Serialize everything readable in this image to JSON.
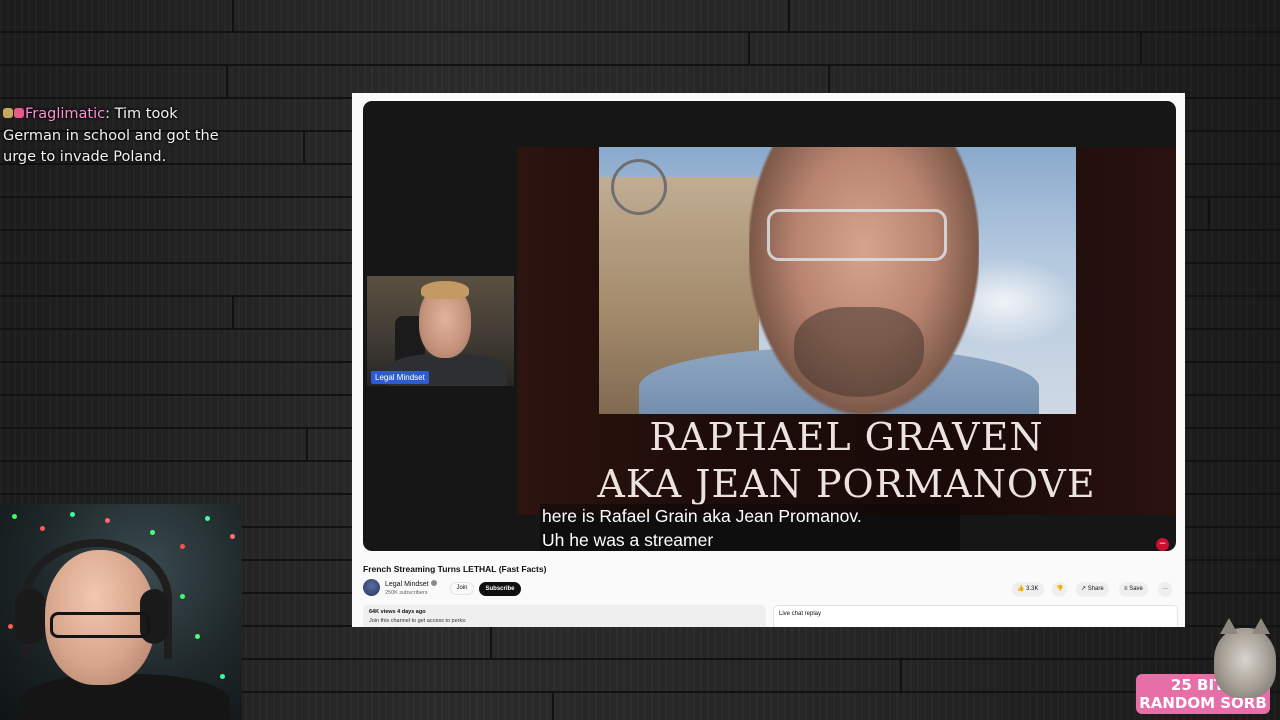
{
  "chat": {
    "username": "Fraglimatic",
    "separator": ":",
    "message": "Tim took German in school and got the urge to invade Poland.",
    "badge_colors": [
      "#c8a860",
      "#e85a8a"
    ]
  },
  "player": {
    "slide_line1": "RAPHAEL GRAVEN",
    "slide_line2": "AKA JEAN PORMANOVE",
    "caption_line1": "here is Rafael Grain aka Jean Promanov.",
    "caption_line2": "Uh he was a streamer",
    "inset_label": "Legal Mindset"
  },
  "video": {
    "title": "French Streaming Turns LETHAL (Fast Facts)",
    "channel": "Legal Mindset",
    "subscribers": "250K subscribers",
    "join_label": "Join",
    "subscribe_label": "Subscribe",
    "likes": "3.3K",
    "share_label": "Share",
    "save_label": "Save",
    "more_label": "···",
    "meta": "64K views  4 days ago",
    "description": "Join this channel to get access to perks:",
    "live_chat_label": "Live chat replay"
  },
  "alert": {
    "amount": "25 BITS",
    "user": "RANDOM SORB",
    "color": "#e76fa8"
  }
}
